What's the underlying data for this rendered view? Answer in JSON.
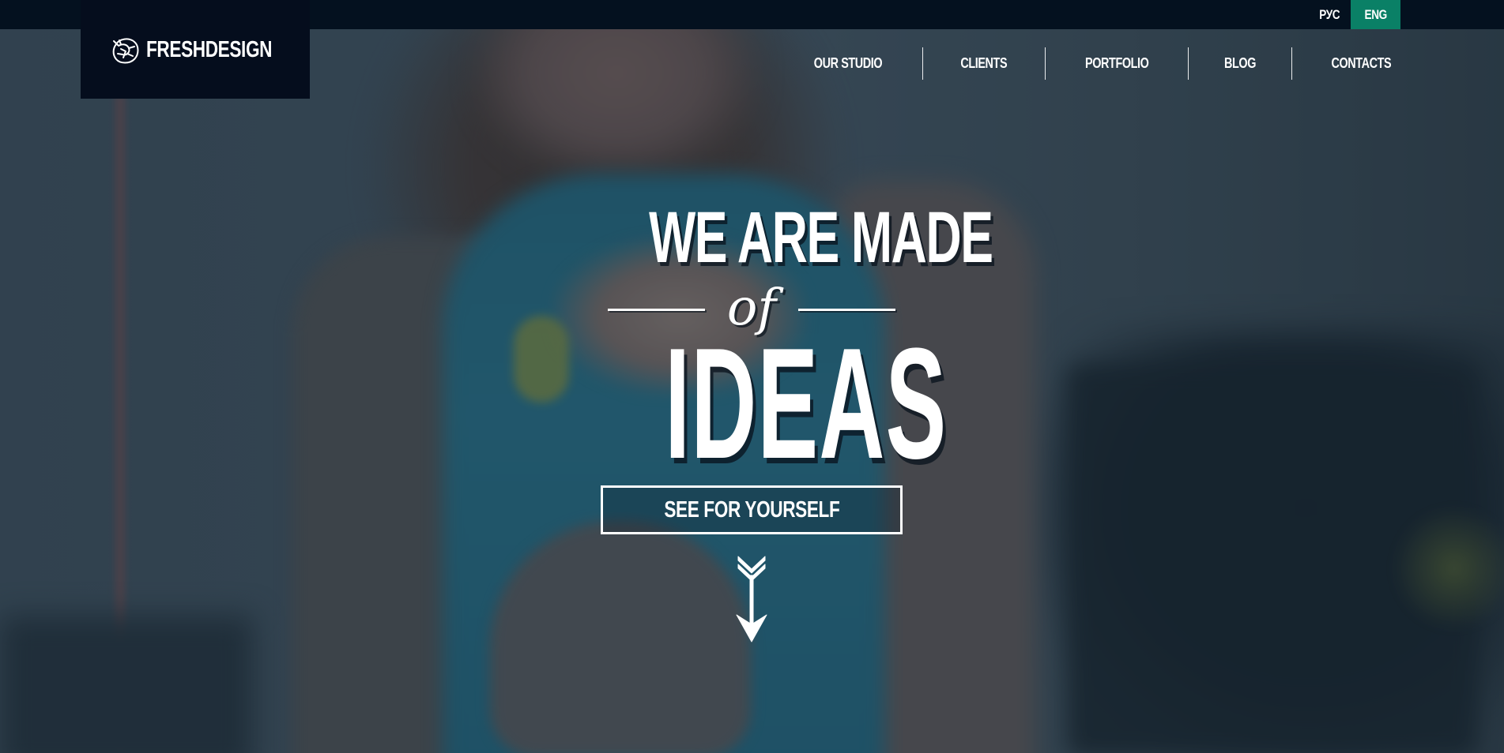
{
  "header": {
    "brand": "FRESHDESIGN",
    "logo_icon": "globe-brain-icon",
    "languages": [
      {
        "label": "РУС",
        "active": false
      },
      {
        "label": "ENG",
        "active": true
      }
    ],
    "nav": [
      {
        "label": "OUR STUDIO"
      },
      {
        "label": "CLIENTS"
      },
      {
        "label": "PORTFOLIO"
      },
      {
        "label": "BLOG"
      },
      {
        "label": "CONTACTS"
      }
    ]
  },
  "hero": {
    "headline_top": "WE ARE MADE",
    "headline_connector": "of",
    "headline_main": "IDEAS",
    "cta_label": "SEE FOR YOURSELF",
    "scroll_icon": "arrow-down-icon"
  },
  "colors": {
    "top_bar": "#04111f",
    "logo_bg": "#050d1d",
    "accent": "#0a8066",
    "text": "#ffffff",
    "overlay": "#0e1e2c"
  }
}
